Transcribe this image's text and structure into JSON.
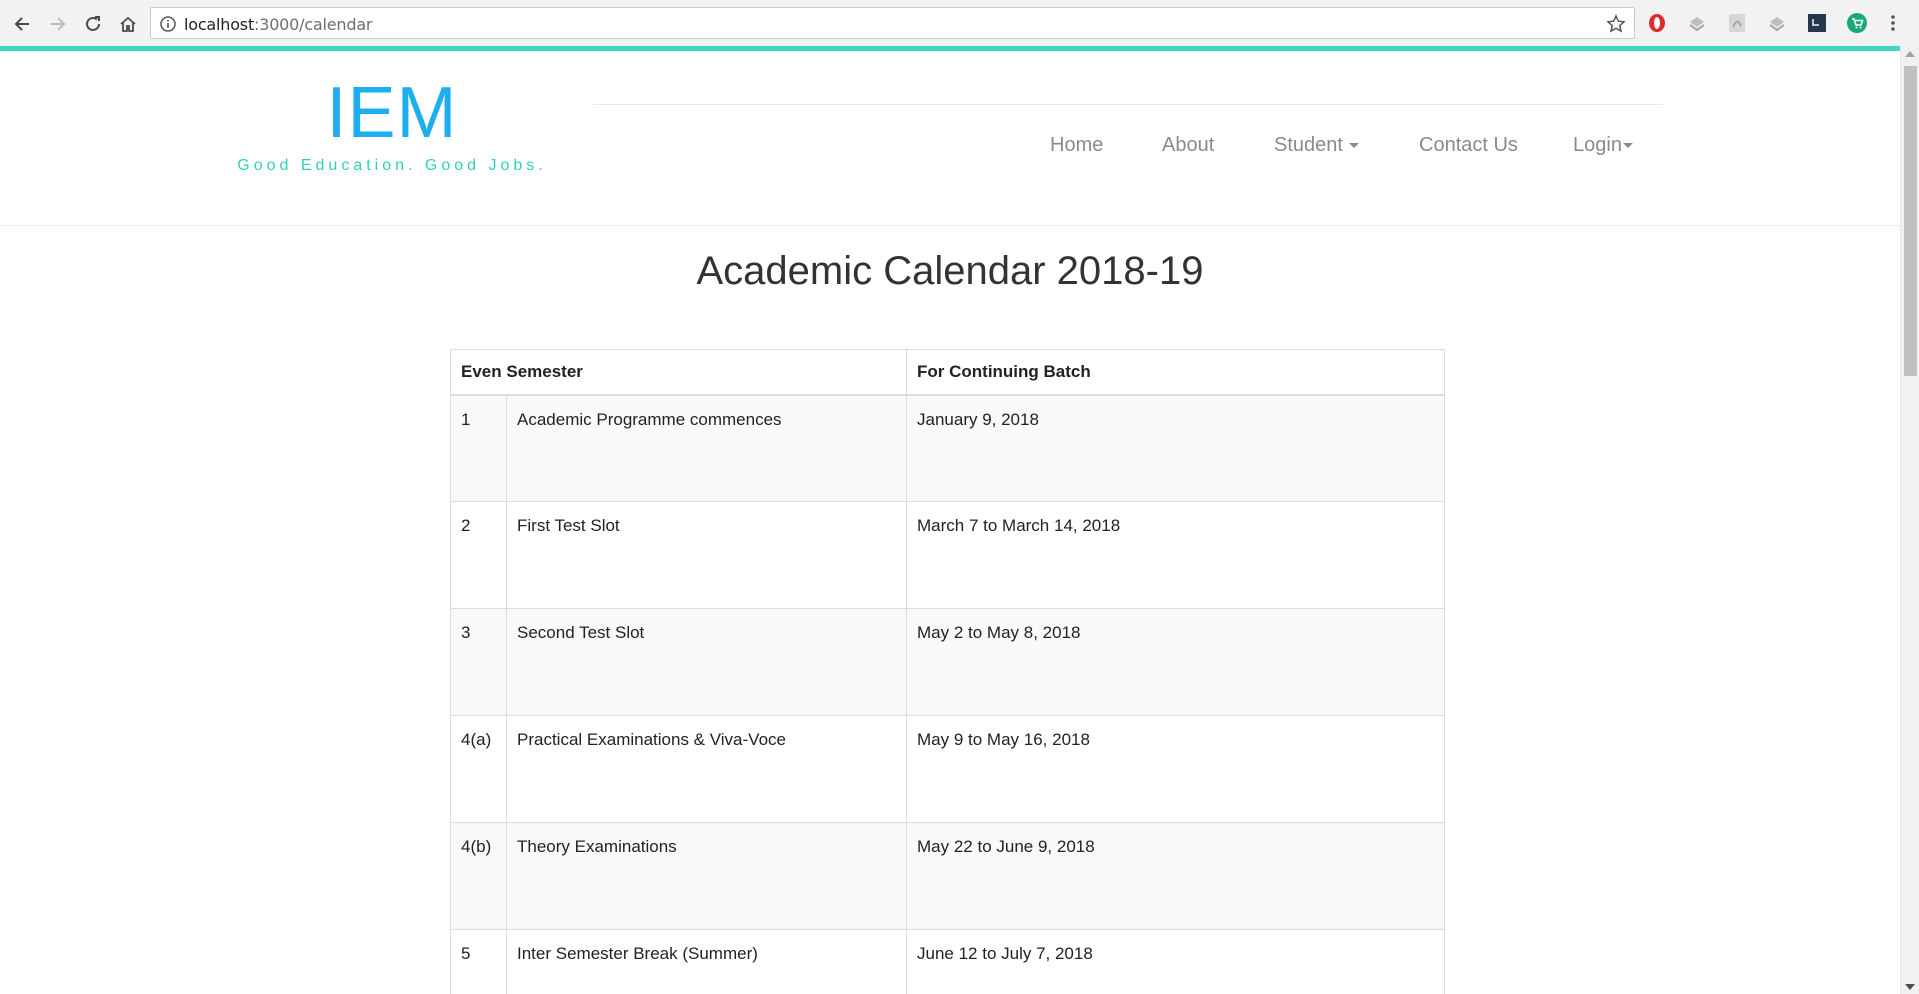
{
  "browser": {
    "url_host": "localhost",
    "url_rest": ":3000/calendar",
    "icons": [
      "back-icon",
      "forward-icon",
      "reload-icon",
      "home-icon",
      "info-icon",
      "star-icon",
      "menu-dots-icon"
    ],
    "extensions": [
      "opera-icon",
      "extension-grey-icon",
      "pdf-icon",
      "extension-grey-icon",
      "screen-capture-icon",
      "cart-icon"
    ]
  },
  "colors": {
    "logo": "#1eaef0",
    "tagline": "#2fd0b9",
    "accent_line": "#3fd6c2",
    "nav_text": "#8a8a8a"
  },
  "site": {
    "logo_title": "IEM",
    "logo_tagline": "Good Education. Good Jobs."
  },
  "nav": {
    "home": "Home",
    "about": "About",
    "student": "Student",
    "contact": "Contact Us",
    "login": "Login"
  },
  "page": {
    "title": "Academic Calendar 2018-19"
  },
  "table": {
    "headers": [
      "Even Semester",
      "For Continuing Batch"
    ],
    "rows": [
      {
        "num": "1",
        "event": "Academic Programme commences",
        "date": "January 9, 2018"
      },
      {
        "num": "2",
        "event": "First Test Slot",
        "date": "March 7 to March 14, 2018"
      },
      {
        "num": "3",
        "event": "Second Test Slot",
        "date": "May 2 to May 8, 2018"
      },
      {
        "num": "4(a)",
        "event": "Practical Examinations & Viva-Voce",
        "date": "May 9 to May 16, 2018"
      },
      {
        "num": "4(b)",
        "event": "Theory Examinations",
        "date": "May 22 to June 9, 2018"
      },
      {
        "num": "5",
        "event": "Inter Semester Break (Summer)",
        "date": "June 12 to July 7, 2018"
      }
    ]
  }
}
